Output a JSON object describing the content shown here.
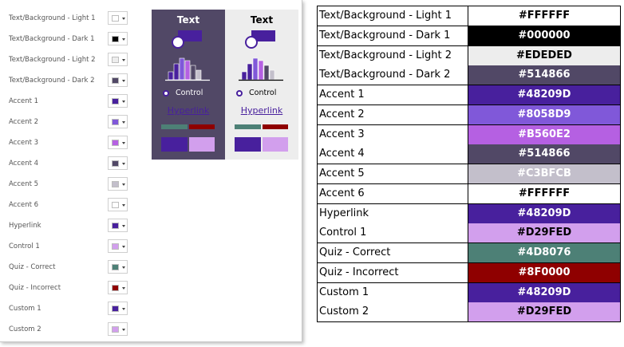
{
  "settings": {
    "rows": [
      {
        "label": "Text/Background - Light 1",
        "color": "#FFFFFF"
      },
      {
        "label": "Text/Background - Dark 1",
        "color": "#000000"
      },
      {
        "label": "Text/Background - Light 2",
        "color": "#EDEDED"
      },
      {
        "label": "Text/Background - Dark 2",
        "color": "#514866"
      },
      {
        "label": "Accent 1",
        "color": "#48209D"
      },
      {
        "label": "Accent 2",
        "color": "#8058D9"
      },
      {
        "label": "Accent 3",
        "color": "#B560E2"
      },
      {
        "label": "Accent 4",
        "color": "#514866"
      },
      {
        "label": "Accent 5",
        "color": "#C3BFCB"
      },
      {
        "label": "Accent 6",
        "color": "#FFFFFF"
      },
      {
        "label": "Hyperlink",
        "color": "#48209D"
      },
      {
        "label": "Control 1",
        "color": "#D29FED"
      },
      {
        "label": "Quiz - Correct",
        "color": "#4D8076"
      },
      {
        "label": "Quiz - Incorrect",
        "color": "#8F0000"
      },
      {
        "label": "Custom 1",
        "color": "#48209D"
      },
      {
        "label": "Custom 2",
        "color": "#D29FED"
      }
    ]
  },
  "preview": {
    "dark": {
      "title": "Text",
      "control_label": "Control",
      "hyperlink": "Hyperlink",
      "background": "#514866",
      "text_color": "#FFFFFF"
    },
    "light": {
      "title": "Text",
      "control_label": "Control",
      "hyperlink": "Hyperlink",
      "background": "#EDEDED",
      "text_color": "#000000"
    }
  },
  "table": {
    "rows": [
      {
        "name": "Text/Background - Light 1",
        "code": "#FFFFFF",
        "bg": "#FFFFFF",
        "fg": "#000000"
      },
      {
        "name": "Text/Background - Dark 1",
        "code": "#000000",
        "bg": "#000000",
        "fg": "#FFFFFF"
      },
      {
        "name": "Text/Background - Light 2",
        "code": "#EDEDED",
        "bg": "#EDEDED",
        "fg": "#000000"
      },
      {
        "name": "Text/Background - Dark 2",
        "code": "#514866",
        "bg": "#514866",
        "fg": "#FFFFFF"
      },
      {
        "name": "Accent 1",
        "code": "#48209D",
        "bg": "#48209D",
        "fg": "#FFFFFF"
      },
      {
        "name": "Accent 2",
        "code": "#8058D9",
        "bg": "#8058D9",
        "fg": "#FFFFFF"
      },
      {
        "name": "Accent 3",
        "code": "#B560E2",
        "bg": "#B560E2",
        "fg": "#FFFFFF"
      },
      {
        "name": "Accent 4",
        "code": "#514866",
        "bg": "#514866",
        "fg": "#FFFFFF"
      },
      {
        "name": "Accent 5",
        "code": "#C3BFCB",
        "bg": "#C3BFCB",
        "fg": "#FFFFFF"
      },
      {
        "name": "Accent 6",
        "code": "#FFFFFF",
        "bg": "#FFFFFF",
        "fg": "#000000"
      },
      {
        "name": "Hyperlink",
        "code": "#48209D",
        "bg": "#48209D",
        "fg": "#FFFFFF"
      },
      {
        "name": "Control 1",
        "code": "#D29FED",
        "bg": "#D29FED",
        "fg": "#000000"
      },
      {
        "name": "Quiz - Correct",
        "code": "#4D8076",
        "bg": "#4D8076",
        "fg": "#FFFFFF"
      },
      {
        "name": "Quiz - Incorrect",
        "code": "#8F0000",
        "bg": "#8F0000",
        "fg": "#FFFFFF"
      },
      {
        "name": "Custom 1",
        "code": "#48209D",
        "bg": "#48209D",
        "fg": "#FFFFFF"
      },
      {
        "name": "Custom 2",
        "code": "#D29FED",
        "bg": "#D29FED",
        "fg": "#000000"
      }
    ]
  }
}
